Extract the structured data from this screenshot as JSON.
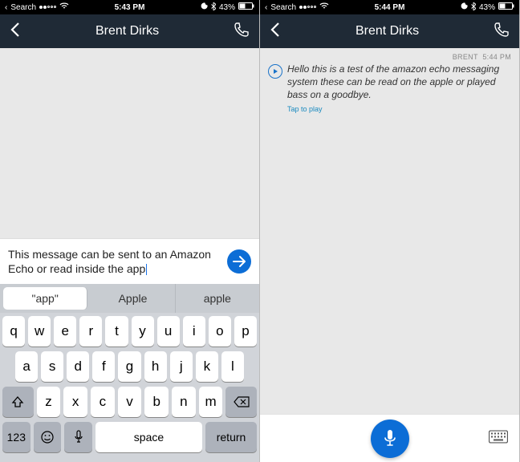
{
  "left": {
    "statusbar": {
      "back_to": "Search",
      "time": "5:43 PM",
      "battery": "43%"
    },
    "header": {
      "title": "Brent Dirks"
    },
    "compose": {
      "text": "This message can be sent to an Amazon Echo or read inside the app"
    },
    "suggestions": [
      "\"app\"",
      "Apple",
      "apple"
    ],
    "keyboard": {
      "row1": [
        "q",
        "w",
        "e",
        "r",
        "t",
        "y",
        "u",
        "i",
        "o",
        "p"
      ],
      "row2": [
        "a",
        "s",
        "d",
        "f",
        "g",
        "h",
        "j",
        "k",
        "l"
      ],
      "row3": [
        "z",
        "x",
        "c",
        "v",
        "b",
        "n",
        "m"
      ],
      "numkey": "123",
      "space": "space",
      "return": "return"
    }
  },
  "right": {
    "statusbar": {
      "back_to": "Search",
      "time": "5:44 PM",
      "battery": "43%"
    },
    "header": {
      "title": "Brent Dirks"
    },
    "message": {
      "sender": "BRENT",
      "time": "5:44 PM",
      "text": "Hello this is a test of the amazon echo messaging system these can be read on the apple or played bass on a goodbye.",
      "tap_play": "Tap to play"
    }
  }
}
